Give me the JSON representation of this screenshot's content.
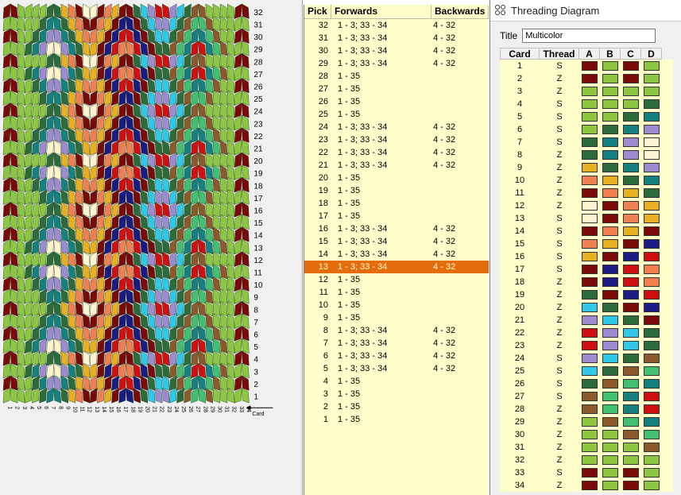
{
  "pattern": {
    "card_numbers": [
      "1",
      "2",
      "3",
      "4",
      "5",
      "6",
      "7",
      "8",
      "9",
      "10",
      "11",
      "12",
      "13",
      "14",
      "15",
      "16",
      "17",
      "18",
      "19",
      "20",
      "21",
      "22",
      "23",
      "24",
      "25",
      "26",
      "27",
      "28",
      "29",
      "30",
      "31",
      "32",
      "33",
      "34"
    ],
    "pick_numbers": [
      "1",
      "2",
      "3",
      "4",
      "5",
      "6",
      "7",
      "8",
      "9",
      "10",
      "11",
      "12",
      "13",
      "14",
      "15",
      "16",
      "17",
      "18",
      "19",
      "20",
      "21",
      "22",
      "23",
      "24",
      "25",
      "26",
      "27",
      "28",
      "29",
      "30",
      "31",
      "32"
    ],
    "card_axis_label": "Card",
    "colors": [
      "#7a0a0a",
      "#8dc63f",
      "#2e6b3c",
      "#148080",
      "#9b8bd0",
      "#fff4d0",
      "#e8b020",
      "#f08050",
      "#1a1a80",
      "#d01010",
      "#30c8e8",
      "#8a5a2a",
      "#40c070"
    ]
  },
  "picks": {
    "headers": {
      "pick": "Pick",
      "forwards": "Forwards",
      "backwards": "Backwards"
    },
    "selected_pick": "13",
    "rows": [
      {
        "pick": "32",
        "forwards": "1 - 3; 33 - 34",
        "backwards": "4 - 32"
      },
      {
        "pick": "31",
        "forwards": "1 - 3; 33 - 34",
        "backwards": "4 - 32"
      },
      {
        "pick": "30",
        "forwards": "1 - 3; 33 - 34",
        "backwards": "4 - 32"
      },
      {
        "pick": "29",
        "forwards": "1 - 3; 33 - 34",
        "backwards": "4 - 32"
      },
      {
        "pick": "28",
        "forwards": "1 - 35",
        "backwards": ""
      },
      {
        "pick": "27",
        "forwards": "1 - 35",
        "backwards": ""
      },
      {
        "pick": "26",
        "forwards": "1 - 35",
        "backwards": ""
      },
      {
        "pick": "25",
        "forwards": "1 - 35",
        "backwards": ""
      },
      {
        "pick": "24",
        "forwards": "1 - 3; 33 - 34",
        "backwards": "4 - 32"
      },
      {
        "pick": "23",
        "forwards": "1 - 3; 33 - 34",
        "backwards": "4 - 32"
      },
      {
        "pick": "22",
        "forwards": "1 - 3; 33 - 34",
        "backwards": "4 - 32"
      },
      {
        "pick": "21",
        "forwards": "1 - 3; 33 - 34",
        "backwards": "4 - 32"
      },
      {
        "pick": "20",
        "forwards": "1 - 35",
        "backwards": ""
      },
      {
        "pick": "19",
        "forwards": "1 - 35",
        "backwards": ""
      },
      {
        "pick": "18",
        "forwards": "1 - 35",
        "backwards": ""
      },
      {
        "pick": "17",
        "forwards": "1 - 35",
        "backwards": ""
      },
      {
        "pick": "16",
        "forwards": "1 - 3; 33 - 34",
        "backwards": "4 - 32"
      },
      {
        "pick": "15",
        "forwards": "1 - 3; 33 - 34",
        "backwards": "4 - 32"
      },
      {
        "pick": "14",
        "forwards": "1 - 3; 33 - 34",
        "backwards": "4 - 32"
      },
      {
        "pick": "13",
        "forwards": "1 - 3; 33 - 34",
        "backwards": "4 - 32"
      },
      {
        "pick": "12",
        "forwards": "1 - 35",
        "backwards": ""
      },
      {
        "pick": "11",
        "forwards": "1 - 35",
        "backwards": ""
      },
      {
        "pick": "10",
        "forwards": "1 - 35",
        "backwards": ""
      },
      {
        "pick": "9",
        "forwards": "1 - 35",
        "backwards": ""
      },
      {
        "pick": "8",
        "forwards": "1 - 3; 33 - 34",
        "backwards": "4 - 32"
      },
      {
        "pick": "7",
        "forwards": "1 - 3; 33 - 34",
        "backwards": "4 - 32"
      },
      {
        "pick": "6",
        "forwards": "1 - 3; 33 - 34",
        "backwards": "4 - 32"
      },
      {
        "pick": "5",
        "forwards": "1 - 3; 33 - 34",
        "backwards": "4 - 32"
      },
      {
        "pick": "4",
        "forwards": "1 - 35",
        "backwards": ""
      },
      {
        "pick": "3",
        "forwards": "1 - 35",
        "backwards": ""
      },
      {
        "pick": "2",
        "forwards": "1 - 35",
        "backwards": ""
      },
      {
        "pick": "1",
        "forwards": "1 - 35",
        "backwards": ""
      }
    ]
  },
  "threading": {
    "window_title": "Threading Diagram",
    "title_label": "Title",
    "title_value": "Multicolor",
    "headers": {
      "card": "Card",
      "thread": "Thread",
      "a": "A",
      "b": "B",
      "c": "C",
      "d": "D"
    },
    "rows": [
      {
        "card": "1",
        "thread": "S",
        "colors": [
          "#7a0a0a",
          "#8dc63f",
          "#7a0a0a",
          "#8dc63f"
        ]
      },
      {
        "card": "2",
        "thread": "Z",
        "colors": [
          "#7a0a0a",
          "#8dc63f",
          "#7a0a0a",
          "#8dc63f"
        ]
      },
      {
        "card": "3",
        "thread": "Z",
        "colors": [
          "#8dc63f",
          "#8dc63f",
          "#8dc63f",
          "#8dc63f"
        ]
      },
      {
        "card": "4",
        "thread": "S",
        "colors": [
          "#8dc63f",
          "#8dc63f",
          "#8dc63f",
          "#2e6b3c"
        ]
      },
      {
        "card": "5",
        "thread": "S",
        "colors": [
          "#8dc63f",
          "#8dc63f",
          "#2e6b3c",
          "#148080"
        ]
      },
      {
        "card": "6",
        "thread": "S",
        "colors": [
          "#8dc63f",
          "#2e6b3c",
          "#148080",
          "#9b8bd0"
        ]
      },
      {
        "card": "7",
        "thread": "S",
        "colors": [
          "#2e6b3c",
          "#148080",
          "#9b8bd0",
          "#fff4d0"
        ]
      },
      {
        "card": "8",
        "thread": "Z",
        "colors": [
          "#2e6b3c",
          "#148080",
          "#9b8bd0",
          "#fff4d0"
        ]
      },
      {
        "card": "9",
        "thread": "Z",
        "colors": [
          "#e8b020",
          "#2e6b3c",
          "#148080",
          "#9b8bd0"
        ]
      },
      {
        "card": "10",
        "thread": "Z",
        "colors": [
          "#f08050",
          "#e8b020",
          "#2e6b3c",
          "#148080"
        ]
      },
      {
        "card": "11",
        "thread": "Z",
        "colors": [
          "#7a0a0a",
          "#f08050",
          "#e8b020",
          "#2e6b3c"
        ]
      },
      {
        "card": "12",
        "thread": "Z",
        "colors": [
          "#fff4d0",
          "#7a0a0a",
          "#f08050",
          "#e8b020"
        ]
      },
      {
        "card": "13",
        "thread": "S",
        "colors": [
          "#fff4d0",
          "#7a0a0a",
          "#f08050",
          "#e8b020"
        ]
      },
      {
        "card": "14",
        "thread": "S",
        "colors": [
          "#7a0a0a",
          "#f08050",
          "#e8b020",
          "#7a0a0a"
        ]
      },
      {
        "card": "15",
        "thread": "S",
        "colors": [
          "#f08050",
          "#e8b020",
          "#7a0a0a",
          "#1a1a80"
        ]
      },
      {
        "card": "16",
        "thread": "S",
        "colors": [
          "#e8b020",
          "#7a0a0a",
          "#1a1a80",
          "#d01010"
        ]
      },
      {
        "card": "17",
        "thread": "S",
        "colors": [
          "#7a0a0a",
          "#1a1a80",
          "#d01010",
          "#f08050"
        ]
      },
      {
        "card": "18",
        "thread": "Z",
        "colors": [
          "#7a0a0a",
          "#1a1a80",
          "#d01010",
          "#f08050"
        ]
      },
      {
        "card": "19",
        "thread": "Z",
        "colors": [
          "#2e6b3c",
          "#7a0a0a",
          "#1a1a80",
          "#d01010"
        ]
      },
      {
        "card": "20",
        "thread": "Z",
        "colors": [
          "#30c8e8",
          "#2e6b3c",
          "#7a0a0a",
          "#1a1a80"
        ]
      },
      {
        "card": "21",
        "thread": "Z",
        "colors": [
          "#9b8bd0",
          "#30c8e8",
          "#2e6b3c",
          "#7a0a0a"
        ]
      },
      {
        "card": "22",
        "thread": "Z",
        "colors": [
          "#d01010",
          "#9b8bd0",
          "#30c8e8",
          "#2e6b3c"
        ]
      },
      {
        "card": "23",
        "thread": "Z",
        "colors": [
          "#d01010",
          "#9b8bd0",
          "#30c8e8",
          "#2e6b3c"
        ]
      },
      {
        "card": "24",
        "thread": "S",
        "colors": [
          "#9b8bd0",
          "#30c8e8",
          "#2e6b3c",
          "#8a5a2a"
        ]
      },
      {
        "card": "25",
        "thread": "S",
        "colors": [
          "#30c8e8",
          "#2e6b3c",
          "#8a5a2a",
          "#40c070"
        ]
      },
      {
        "card": "26",
        "thread": "S",
        "colors": [
          "#2e6b3c",
          "#8a5a2a",
          "#40c070",
          "#148080"
        ]
      },
      {
        "card": "27",
        "thread": "S",
        "colors": [
          "#8a5a2a",
          "#40c070",
          "#148080",
          "#d01010"
        ]
      },
      {
        "card": "28",
        "thread": "Z",
        "colors": [
          "#8a5a2a",
          "#40c070",
          "#148080",
          "#d01010"
        ]
      },
      {
        "card": "29",
        "thread": "Z",
        "colors": [
          "#8dc63f",
          "#8a5a2a",
          "#40c070",
          "#148080"
        ]
      },
      {
        "card": "30",
        "thread": "Z",
        "colors": [
          "#8dc63f",
          "#8dc63f",
          "#8a5a2a",
          "#40c070"
        ]
      },
      {
        "card": "31",
        "thread": "Z",
        "colors": [
          "#8dc63f",
          "#8dc63f",
          "#8dc63f",
          "#8a5a2a"
        ]
      },
      {
        "card": "32",
        "thread": "Z",
        "colors": [
          "#8dc63f",
          "#8dc63f",
          "#8dc63f",
          "#8dc63f"
        ]
      },
      {
        "card": "33",
        "thread": "S",
        "colors": [
          "#7a0a0a",
          "#8dc63f",
          "#7a0a0a",
          "#8dc63f"
        ]
      },
      {
        "card": "34",
        "thread": "Z",
        "colors": [
          "#7a0a0a",
          "#8dc63f",
          "#7a0a0a",
          "#8dc63f"
        ]
      }
    ]
  }
}
